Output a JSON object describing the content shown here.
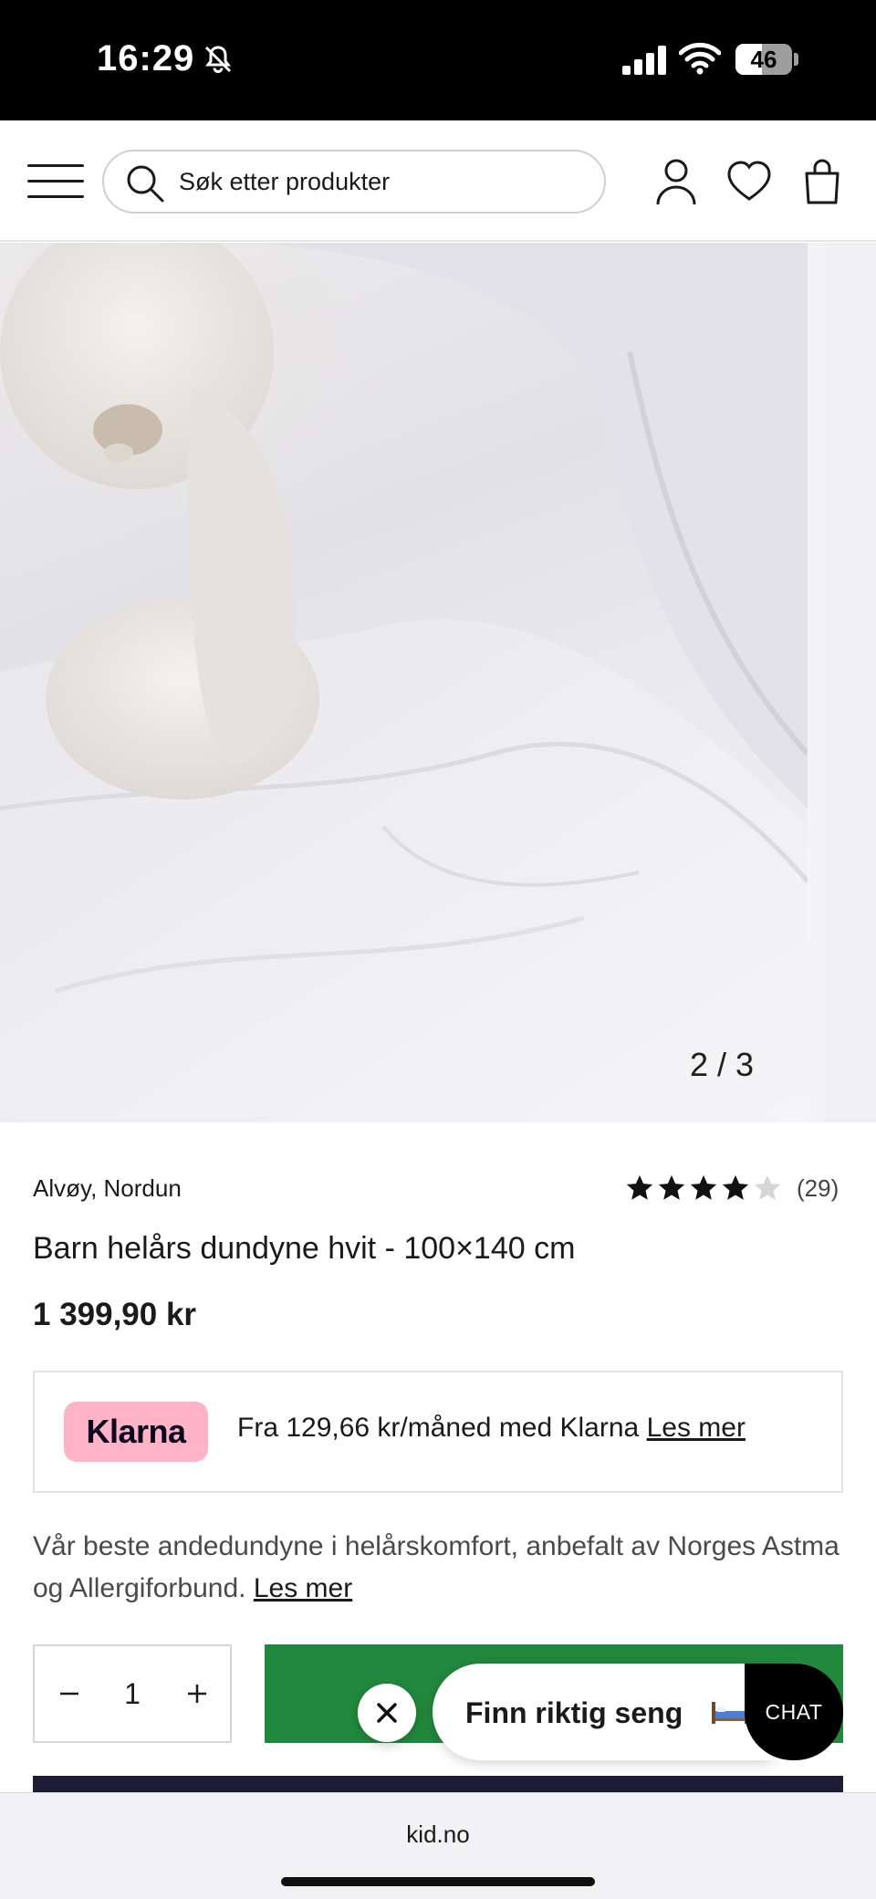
{
  "status_bar": {
    "time": "16:29",
    "battery": "46",
    "battery_level": 0.46,
    "icons": [
      "bell-slash-icon",
      "signal-icon",
      "wifi-icon",
      "battery-icon"
    ]
  },
  "header": {
    "search_placeholder": "Søk etter produkter",
    "icons": [
      "menu-icon",
      "search-icon",
      "user-icon",
      "heart-icon",
      "bag-icon"
    ]
  },
  "gallery": {
    "pager": "2 / 3"
  },
  "product": {
    "brand": "Alvøy, Nordun",
    "rating": 4,
    "rating_max": 5,
    "rating_count": "(29)",
    "title": "Barn helårs dundyne hvit - 100×140 cm",
    "price": "1 399,90 kr"
  },
  "klarna": {
    "badge": "Klarna",
    "text": "Fra 129,66 kr/måned med Klarna",
    "link": "Les mer",
    "badge_color": "#ffb3c7"
  },
  "description": {
    "text": "Vår beste andedundyne i helårskomfort, anbefalt av Norges Astma og Allergiforbund.",
    "link": "Les mer"
  },
  "quantity": {
    "value": "1"
  },
  "colors": {
    "add_to_cart": "#21893d",
    "dark_button": "#1c1c35"
  },
  "chat": {
    "bubble_text": "Finn riktig seng",
    "button_label": "CHAT"
  },
  "browser": {
    "url": "kid.no"
  }
}
